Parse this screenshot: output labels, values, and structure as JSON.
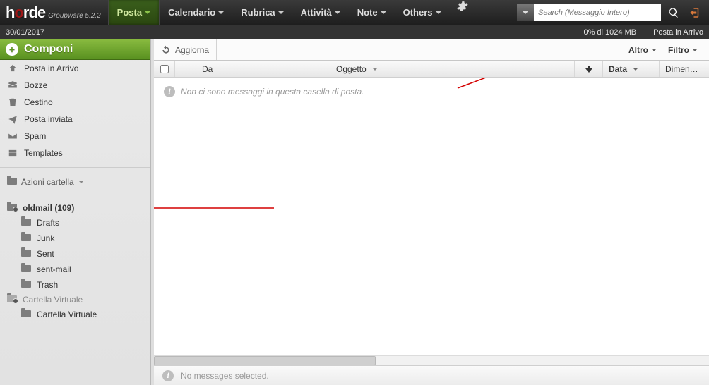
{
  "brand": {
    "word_pre": "h",
    "word_o": "o",
    "word_post": "rde",
    "sub": "Groupware 5.2.2"
  },
  "nav": {
    "posta": "Posta",
    "calendario": "Calendario",
    "rubrica": "Rubrica",
    "attivita": "Attività",
    "note": "Note",
    "others": "Others"
  },
  "search": {
    "placeholder": "Search (Messaggio Intero)"
  },
  "infobar": {
    "date": "30/01/2017",
    "quota": "0% di 1024 MB",
    "folder": "Posta in Arrivo"
  },
  "sidebar": {
    "compose": "Componi",
    "inbox": "Posta in Arrivo",
    "drafts": "Bozze",
    "trash": "Cestino",
    "sent": "Posta inviata",
    "spam": "Spam",
    "templates": "Templates",
    "actions": "Azioni cartella",
    "oldmail": "oldmail (109)",
    "sub_drafts": "Drafts",
    "sub_junk": "Junk",
    "sub_sent": "Sent",
    "sub_sentmail": "sent-mail",
    "sub_trash": "Trash",
    "vfolder": "Cartella Virtuale",
    "vfolder2": "Cartella Virtuale"
  },
  "toolbar": {
    "refresh": "Aggiorna",
    "more": "Altro",
    "filter": "Filtro"
  },
  "columns": {
    "from": "Da",
    "subject": "Oggetto",
    "date": "Data",
    "size": "Dimen…"
  },
  "empty_msg": "Non ci sono messaggi in questa casella di posta.",
  "status": "No messages selected."
}
